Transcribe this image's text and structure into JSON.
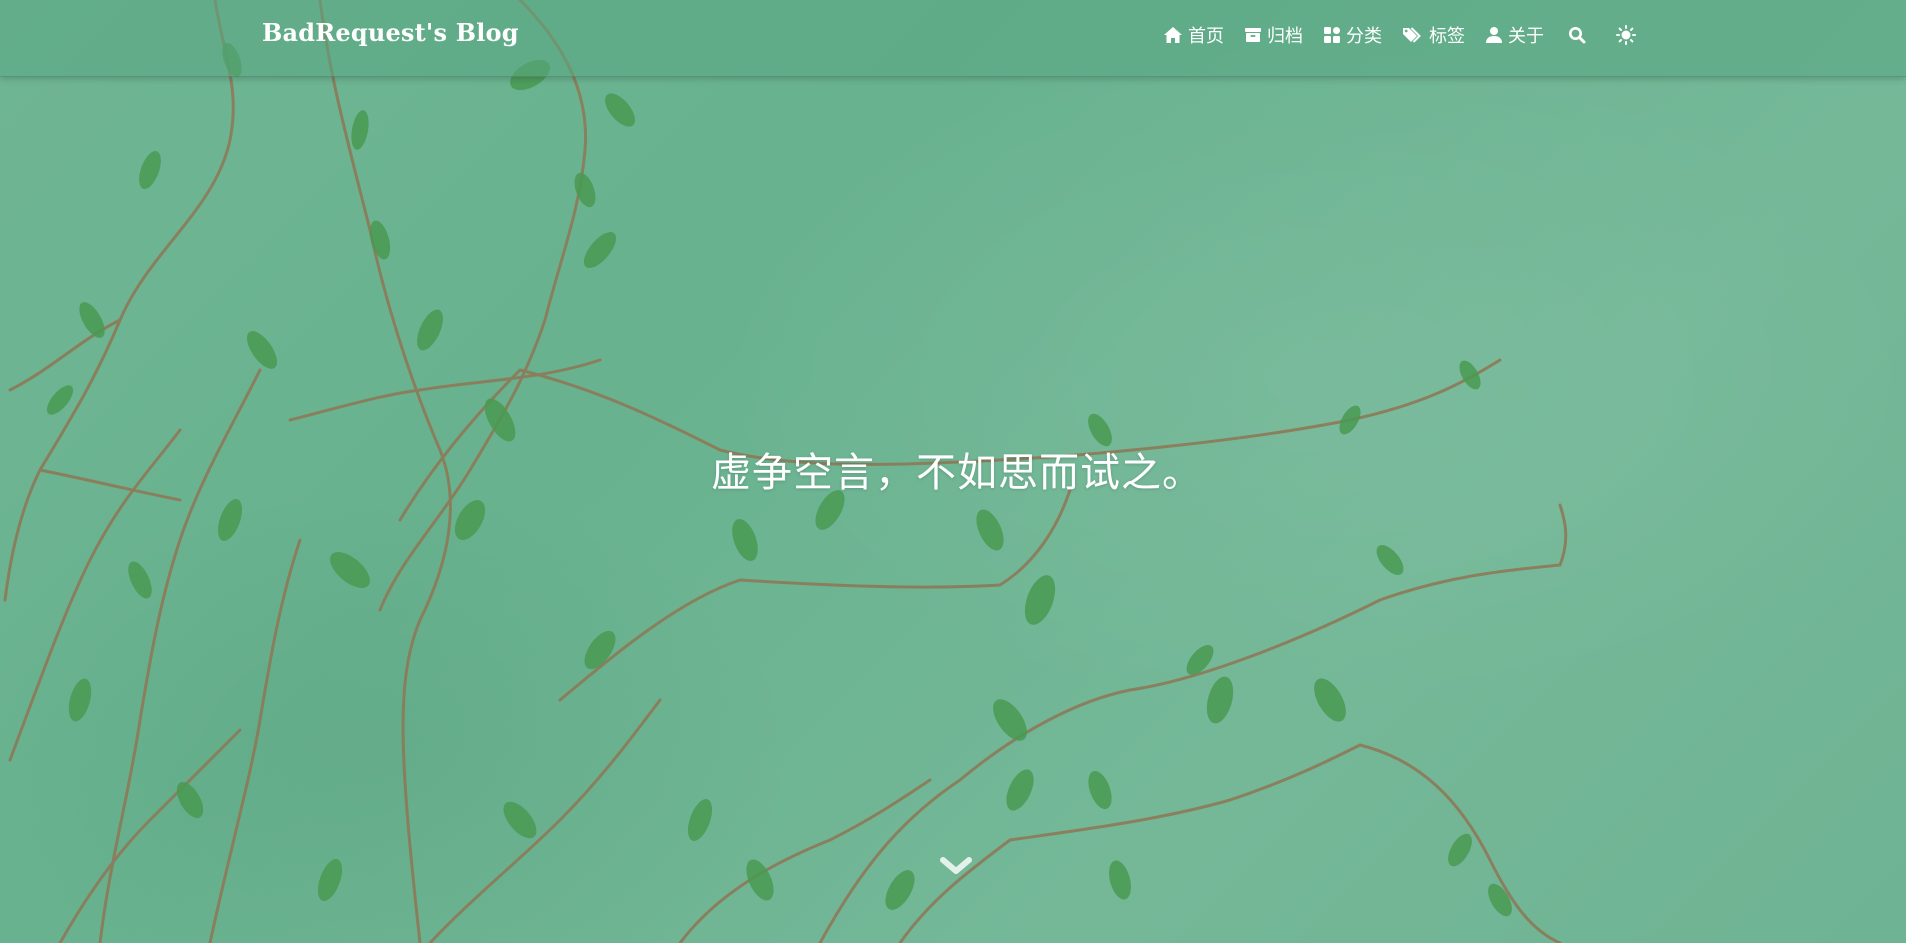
{
  "header": {
    "brand": "BadRequest's Blog"
  },
  "nav": {
    "items": [
      {
        "icon": "home-icon",
        "label": "首页"
      },
      {
        "icon": "archive-icon",
        "label": "归档"
      },
      {
        "icon": "category-icon",
        "label": "分类"
      },
      {
        "icon": "tags-icon",
        "label": "标签"
      },
      {
        "icon": "user-icon",
        "label": "关于"
      }
    ],
    "search_icon": "search-icon",
    "theme_icon": "sun-icon"
  },
  "hero": {
    "slogan": "虚争空言，不如思而试之。",
    "scroll_icon": "chevron-down-icon"
  },
  "colors": {
    "background": "#6fb594",
    "navbar": "#5aa582",
    "text": "#ffffff",
    "vine_stem": "#8a7a5a",
    "leaf": "#3f8f4a"
  }
}
